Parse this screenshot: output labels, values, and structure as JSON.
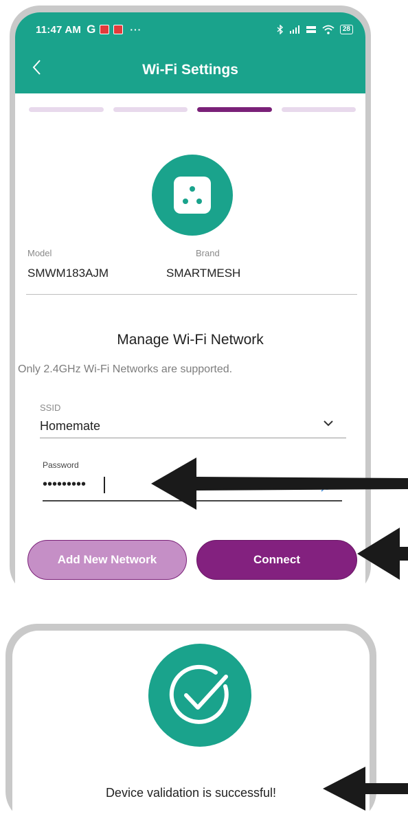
{
  "status_bar": {
    "time": "11:47 AM",
    "carrier_icon": "G",
    "dots": "···",
    "battery": "28"
  },
  "header": {
    "back_icon": "chevron-left-icon",
    "title": "Wi-Fi Settings"
  },
  "progress": {
    "total_steps": 4,
    "current_step": 3
  },
  "device": {
    "model_label": "Model",
    "model_value": "SMWM183AJM",
    "brand_label": "Brand",
    "brand_value": "SMARTMESH"
  },
  "network": {
    "title": "Manage Wi-Fi Network",
    "note": "Only 2.4GHz Wi-Fi Networks are supported.",
    "ssid_label": "SSID",
    "ssid_value": "Homemate",
    "password_label": "Password",
    "password_value": "•••••••••"
  },
  "buttons": {
    "add_network": "Add New Network",
    "connect": "Connect"
  },
  "success": {
    "message": "Device validation is successful!"
  },
  "colors": {
    "primary_teal": "#1aa38c",
    "accent_purple": "#83217f",
    "light_purple": "#c58fc6"
  }
}
